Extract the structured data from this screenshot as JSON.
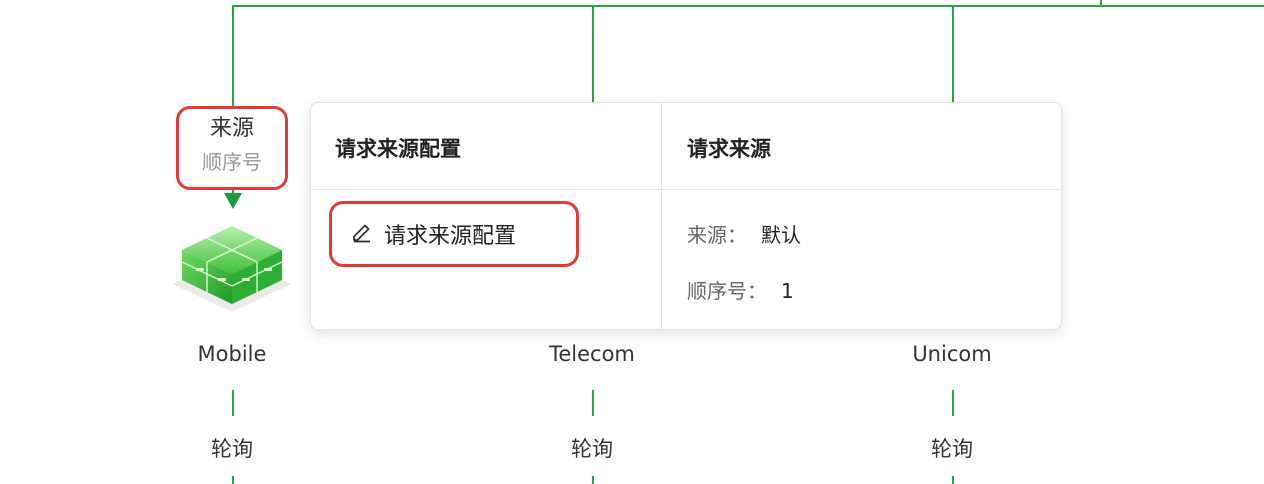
{
  "source_label": {
    "title": "来源",
    "subtitle": "顺序号"
  },
  "nodes": [
    {
      "name": "Mobile",
      "poll": "轮询"
    },
    {
      "name": "Telecom",
      "poll": "轮询"
    },
    {
      "name": "Unicom",
      "poll": "轮询"
    }
  ],
  "popover": {
    "left_header": "请求来源配置",
    "right_header": "请求来源",
    "action_label": "请求来源配置",
    "details": [
      {
        "key": "来源：",
        "value": "默认"
      },
      {
        "key": "顺序号：",
        "value": "1"
      }
    ]
  },
  "colors": {
    "line": "#2aa44a",
    "highlight": "#e53935"
  },
  "icons": [
    "edit-icon",
    "server-cube-icon"
  ]
}
